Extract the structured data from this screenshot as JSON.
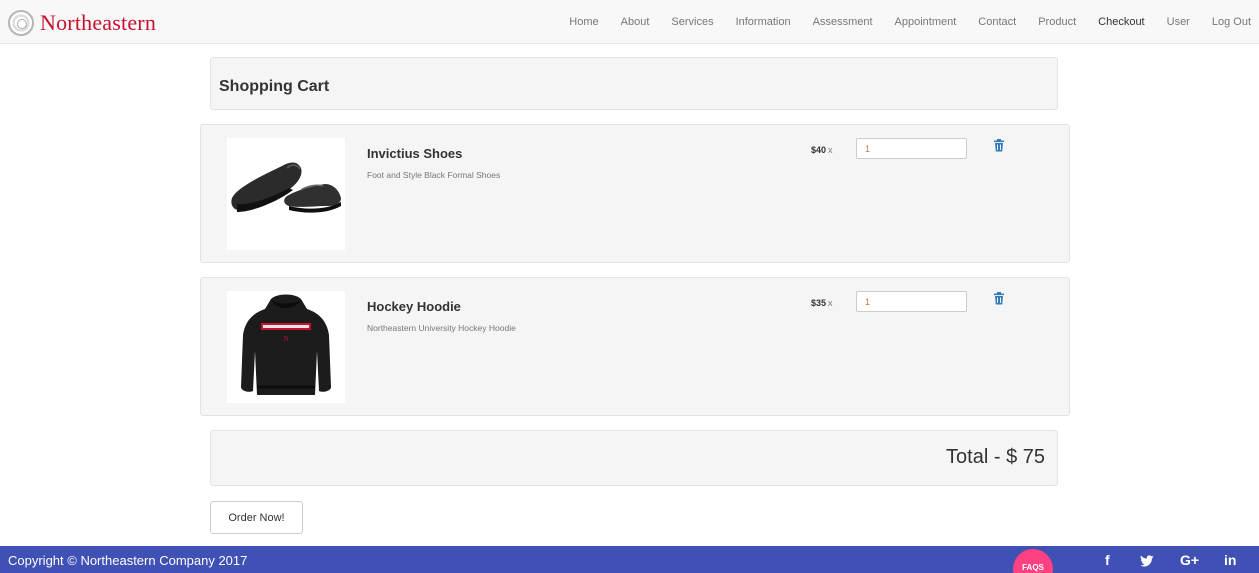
{
  "navbar": {
    "brand": "Northeastern",
    "links": [
      "Home",
      "About",
      "Services",
      "Information",
      "Assessment",
      "Appointment",
      "Contact",
      "Product",
      "Checkout",
      "User",
      "Log Out"
    ],
    "active": "Checkout"
  },
  "cart": {
    "title": "Shopping Cart",
    "items": [
      {
        "name": "Invictius Shoes",
        "description": "Foot and Style Black Formal Shoes",
        "price": "$40",
        "multiplier": "x",
        "quantity": "1",
        "image_icon": "shoes-image"
      },
      {
        "name": "Hockey Hoodie",
        "description": "Northeastern University Hockey Hoodie",
        "price": "$35",
        "multiplier": "x",
        "quantity": "1",
        "image_icon": "hoodie-image"
      }
    ],
    "total": "Total - $ 75",
    "order_button": "Order Now!"
  },
  "footer": {
    "copyright": "Copyright © Northeastern Company 2017",
    "faqs": "FAQS",
    "social": [
      "f",
      "✒",
      "G+",
      "in"
    ]
  },
  "colors": {
    "brand_red": "#c8102e",
    "footer_blue": "#3f51b5",
    "faqs_pink": "#ff4081",
    "trash_blue": "#337ab7"
  }
}
